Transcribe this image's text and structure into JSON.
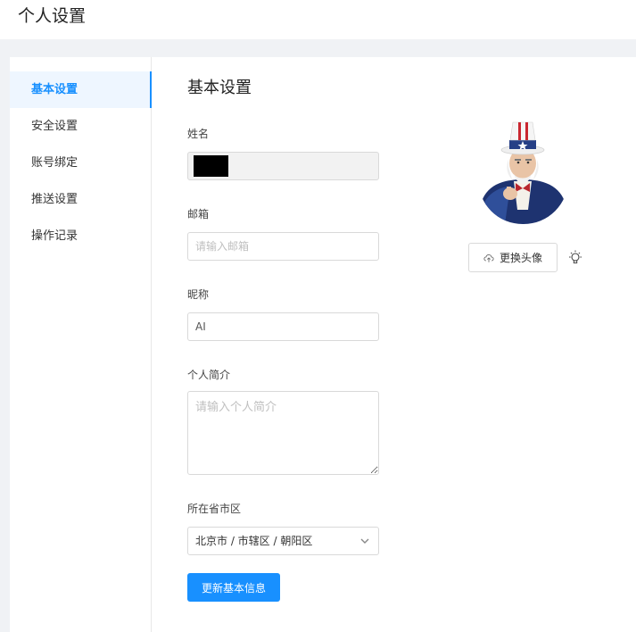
{
  "header": {
    "title": "个人设置"
  },
  "sidebar": {
    "items": [
      {
        "label": "基本设置",
        "active": true
      },
      {
        "label": "安全设置",
        "active": false
      },
      {
        "label": "账号绑定",
        "active": false
      },
      {
        "label": "推送设置",
        "active": false
      },
      {
        "label": "操作记录",
        "active": false
      }
    ]
  },
  "form": {
    "section_title": "基本设置",
    "name": {
      "label": "姓名",
      "value": ""
    },
    "email": {
      "label": "邮箱",
      "value": "",
      "placeholder": "请输入邮箱"
    },
    "nickname": {
      "label": "昵称",
      "value": "AI"
    },
    "bio": {
      "label": "个人简介",
      "value": "",
      "placeholder": "请输入个人简介"
    },
    "region": {
      "label": "所在省市区",
      "value": "北京市 / 市辖区 / 朝阳区"
    },
    "submit_label": "更新基本信息"
  },
  "avatar": {
    "upload_label": "更换头像",
    "upload_icon": "cloud-upload-icon",
    "extra_icon": "bulb-icon"
  },
  "colors": {
    "primary": "#1890ff",
    "active_bg": "#eef6ff",
    "page_bg": "#f0f2f5"
  }
}
